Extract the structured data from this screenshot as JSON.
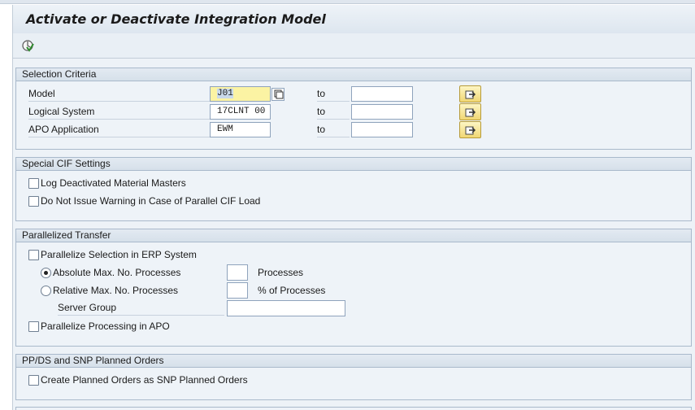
{
  "window": {
    "title": "Activate or Deactivate Integration Model"
  },
  "toolbar": {
    "execute_icon": "execute-icon"
  },
  "selection_criteria": {
    "title": "Selection Criteria",
    "to_label": "to",
    "rows": [
      {
        "label": "Model",
        "value": "J01",
        "to_value": ""
      },
      {
        "label": "Logical System",
        "value": "17CLNT 00",
        "to_value": ""
      },
      {
        "label": "APO Application",
        "value": "EWM",
        "to_value": ""
      }
    ]
  },
  "special_cif": {
    "title": "Special CIF Settings",
    "options": [
      {
        "label": "Log Deactivated Material Masters",
        "checked": false
      },
      {
        "label": "Do Not Issue Warning in Case of Parallel CIF Load",
        "checked": false
      }
    ]
  },
  "parallelized": {
    "title": "Parallelized Transfer",
    "parallelize_erp": "Parallelize Selection in ERP System",
    "absolute_label": "Absolute Max. No. Processes",
    "absolute_unit": "Processes",
    "absolute_value": "",
    "relative_label": "Relative Max. No. Processes",
    "relative_unit": "% of Processes",
    "relative_value": "",
    "server_group_label": "Server Group",
    "server_group_value": "",
    "parallelize_apo": "Parallelize Processing in APO"
  },
  "ppds": {
    "title": "PP/DS and SNP Planned Orders",
    "create_label": "Create Planned Orders as SNP Planned Orders"
  }
}
